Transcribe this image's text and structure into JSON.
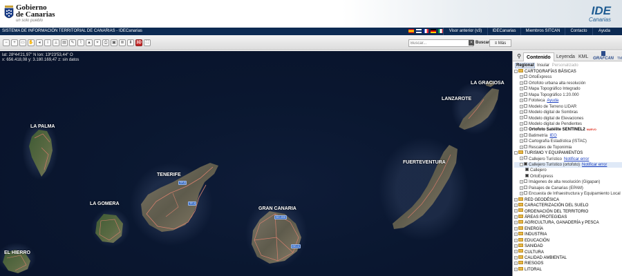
{
  "header": {
    "brand_line1": "Gobierno",
    "brand_line2": "de Canarias",
    "brand_tagline": "un solo pueblo",
    "ide_logo_main": "IDE",
    "ide_logo_sub": "Canarias"
  },
  "nav": {
    "title": "SISTEMA DE INFORMACIÓN TERRITORIAL DE CANARIAS - IDECanarias",
    "links": [
      "Visor anterior (v3)",
      "IDECanarias",
      "Miembros SITCAN",
      "Contacto",
      "Ayuda"
    ],
    "flag_colors": [
      "#c60b1e",
      "#012169",
      "#002395",
      "#dd0000",
      "#009246"
    ]
  },
  "toolbar": {
    "tool_3d_label": "3D",
    "search_placeholder": "Buscar...",
    "search_clear": "×",
    "search_button": "Buscar",
    "more_button": "≡ Más"
  },
  "map": {
    "coords_line1": "lat: 28º44'21,97\" N  lon: 13º23'53,44\" O",
    "coords_line2": "x: 656.418,08  y: 3.180.169,47  z: sin datos",
    "islands": {
      "la_graciosa": "LA GRACIOSA",
      "lanzarote": "LANZAROTE",
      "la_palma": "LA PALMA",
      "fuerteventura": "FUERTEVENTURA",
      "tenerife": "TENERIFE",
      "la_gomera": "LA GOMERA",
      "gran_canaria": "GRAN CANARIA",
      "el_hierro": "EL HIERRO"
    },
    "road_badges": {
      "tf5": "TF-5",
      "tf1": "TF-1",
      "gc200": "GC-200",
      "gc1": "GC-1"
    }
  },
  "sidebar": {
    "tab_search_icon": "search-icon",
    "tabs": [
      "Contenido",
      "Leyenda",
      "KML"
    ],
    "grafcan_label": "GRAFCAN",
    "grafcan_mark": "TM",
    "subtabs": [
      "Regional",
      "Insular",
      "Personalizado"
    ],
    "tree": [
      {
        "label": "CARTOGRAFÍAS BÁSICAS",
        "type": "folder",
        "level": 0,
        "exp": "-"
      },
      {
        "label": "OrtoExpress",
        "type": "layer",
        "level": 1,
        "exp": "+"
      },
      {
        "label": "Ortofoto urbana alta resolución",
        "type": "layer",
        "level": 1,
        "exp": "+"
      },
      {
        "label": "Mapa Topográfico Integrado",
        "type": "layer",
        "level": 1,
        "exp": "+"
      },
      {
        "label": "Mapa Topográfico 1:20.000",
        "type": "layer",
        "level": 1,
        "exp": "+"
      },
      {
        "label": "Fototeca",
        "type": "layer",
        "level": 1,
        "exp": "+",
        "link": "Ayuda"
      },
      {
        "label": "Modelo de Terreno LIDAR",
        "type": "layer",
        "level": 1,
        "exp": "+"
      },
      {
        "label": "Modelo digital de Sombras",
        "type": "layer",
        "level": 1,
        "exp": "+"
      },
      {
        "label": "Modelo digital de Elevaciones",
        "type": "layer",
        "level": 1,
        "exp": "+"
      },
      {
        "label": "Modelo digital de Pendientes",
        "type": "layer",
        "level": 1,
        "exp": "+"
      },
      {
        "label": "Ortofoto Satélite SENTINEL2",
        "type": "layer",
        "level": 1,
        "exp": "+",
        "bold": true,
        "tag": "NUEVO"
      },
      {
        "label": "Batimetría",
        "type": "layer",
        "level": 1,
        "exp": "+",
        "link": "IEO"
      },
      {
        "label": "Cartografía Estadística (ISTAC)",
        "type": "layer",
        "level": 1,
        "exp": "+"
      },
      {
        "label": "Rescates de Toponimia",
        "type": "layer",
        "level": 1,
        "exp": "+"
      },
      {
        "label": "TURISMO Y EQUIPAMIENTOS",
        "type": "folder",
        "level": 0,
        "exp": "-"
      },
      {
        "label": "Callejero Turístico",
        "type": "layer",
        "level": 1,
        "exp": "+",
        "link": "Notificar error"
      },
      {
        "label": "Callejero Turístico (ortofoto)",
        "type": "layer",
        "level": 1,
        "exp": "-",
        "checked": true,
        "link": "Notificar error",
        "highlight": true
      },
      {
        "label": "Callejero",
        "type": "layer",
        "level": 2,
        "checked": true
      },
      {
        "label": "OrtoExpress",
        "type": "layer",
        "level": 2,
        "checked": true
      },
      {
        "label": "Imágenes de alta resolución (Gigapan)",
        "type": "layer",
        "level": 1,
        "exp": "+"
      },
      {
        "label": "Paisajes de Canarias (EPAM)",
        "type": "layer",
        "level": 1,
        "exp": "+"
      },
      {
        "label": "Encuesta de Infraestructura y Equipamiento Local",
        "type": "layer",
        "level": 1,
        "exp": "+"
      },
      {
        "label": "RED GEODÉSICA",
        "type": "folder",
        "level": 0,
        "exp": "+"
      },
      {
        "label": "CARACTERIZACIÓN DEL SUELO",
        "type": "folder",
        "level": 0,
        "exp": "+"
      },
      {
        "label": "ORDENACIÓN DEL TERRITORIO",
        "type": "folder",
        "level": 0,
        "exp": "+"
      },
      {
        "label": "ÁREAS PROTEGIDAS",
        "type": "folder",
        "level": 0,
        "exp": "+"
      },
      {
        "label": "AGRICULTURA, GANADERÍA y PESCA",
        "type": "folder",
        "level": 0,
        "exp": "+"
      },
      {
        "label": "ENERGÍA",
        "type": "folder",
        "level": 0,
        "exp": "+"
      },
      {
        "label": "INDUSTRIA",
        "type": "folder",
        "level": 0,
        "exp": "+"
      },
      {
        "label": "EDUCACIÓN",
        "type": "folder",
        "level": 0,
        "exp": "+"
      },
      {
        "label": "SANIDAD",
        "type": "folder",
        "level": 0,
        "exp": "+"
      },
      {
        "label": "CULTURA",
        "type": "folder",
        "level": 0,
        "exp": "+"
      },
      {
        "label": "CALIDAD AMBIENTAL",
        "type": "folder",
        "level": 0,
        "exp": "+"
      },
      {
        "label": "RIESGOS",
        "type": "folder",
        "level": 0,
        "exp": "+"
      },
      {
        "label": "LITORAL",
        "type": "folder",
        "level": 0,
        "exp": "+"
      }
    ]
  }
}
